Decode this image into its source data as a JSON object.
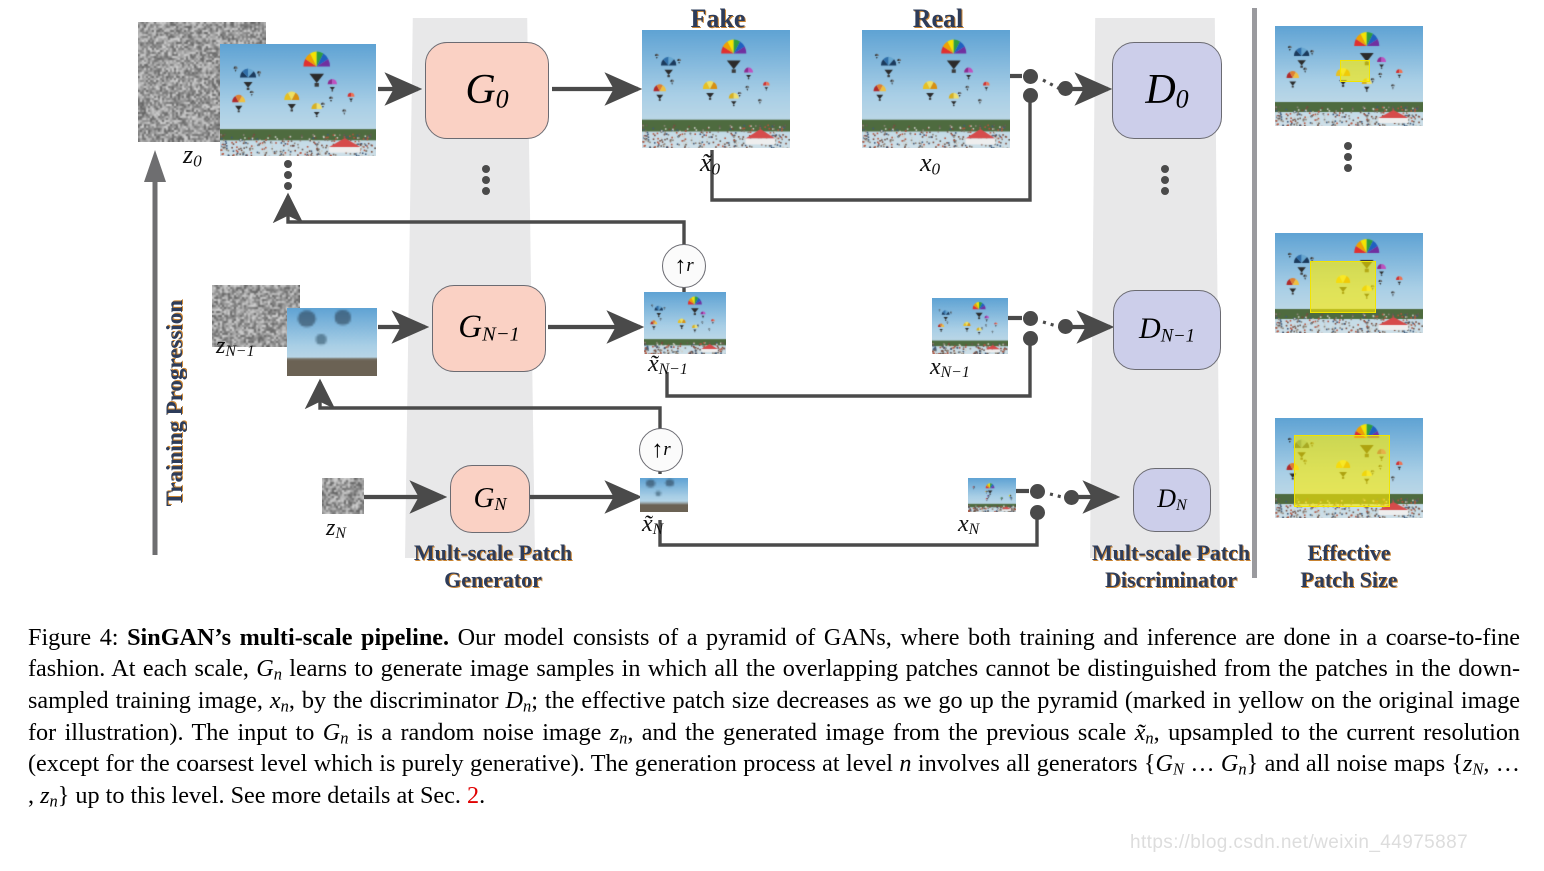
{
  "figure": {
    "training_progression_label": "Training Progression",
    "column_labels": {
      "fake": "Fake",
      "real": "Real",
      "generator_line1": "Mult-scale Patch",
      "generator_line2": "Generator",
      "discriminator_line1": "Mult-scale Patch",
      "discriminator_line2": "Discriminator",
      "patch_line1": "Effective",
      "patch_line2": "Patch Size"
    },
    "generators": [
      {
        "name": "G",
        "sub": "0",
        "noise": "z",
        "noise_sub": "0",
        "fake": "x̃",
        "fake_sub": "0",
        "real": "x",
        "real_sub": "0",
        "disc": "D",
        "disc_sub": "0"
      },
      {
        "name": "G",
        "sub": "N−1",
        "noise": "z",
        "noise_sub": "N−1",
        "fake": "x̃",
        "fake_sub": "N−1",
        "real": "x",
        "real_sub": "N−1",
        "disc": "D",
        "disc_sub": "N−1"
      },
      {
        "name": "G",
        "sub": "N",
        "noise": "z",
        "noise_sub": "N",
        "fake": "x̃",
        "fake_sub": "N",
        "real": "x",
        "real_sub": "N",
        "disc": "D",
        "disc_sub": "N"
      }
    ],
    "upsample_symbol": "↑",
    "upsample_rate": "r",
    "ellipsis_glyph": "⋮",
    "colors": {
      "generator_box": "#fad1c4",
      "discriminator_box": "#ccceea",
      "column_bg": "#e8e8e9",
      "wire": "#4a4a4a",
      "label_navy": "#2d3c5a",
      "label_orange": "#c98432",
      "patch_yellow": "#ffed00",
      "link_red": "#e00000"
    }
  },
  "caption": {
    "figure_number": "Figure 4:",
    "title": "SinGAN’s multi-scale pipeline.",
    "body_1": " Our model consists of a pyramid of GANs, where both training and inference are done in a coarse-to-fine fashion. At each scale, ",
    "m_gn_1": "G",
    "m_gn_1_sub": "n",
    "body_2": " learns to generate image samples in which all the overlapping patches cannot be distinguished from the patches in the down-sampled training image, ",
    "m_xn": "x",
    "m_xn_sub": "n",
    "body_3": ", by the discriminator ",
    "m_dn": "D",
    "m_dn_sub": "n",
    "body_4": "; the effective patch size decreases as we go up the pyramid (marked in yellow on the original image for illustration). The input to ",
    "m_gn_2": "G",
    "m_gn_2_sub": "n",
    "body_5": " is a random noise image ",
    "m_zn": "z",
    "m_zn_sub": "n",
    "body_6": ", and the generated image from the previous scale ",
    "m_xtn": "x̃",
    "m_xtn_sub": "n",
    "body_7": ", upsampled to the current resolution (except for the coarsest level which is purely generative). The generation process at level ",
    "m_n": "n",
    "body_8": " involves all generators {",
    "m_GN": "G",
    "m_GN_sub": "N",
    "body_9": " … ",
    "m_Gn3": "G",
    "m_Gn3_sub": "n",
    "body_10": "} and all noise maps {",
    "m_zN": "z",
    "m_zN_sub": "N",
    "body_11": ", … , ",
    "m_zn2": "z",
    "m_zn2_sub": "n",
    "body_12": "} up to this level. See more details at Sec. ",
    "link": "2",
    "body_13": "."
  },
  "watermark": "https://blog.csdn.net/weixin_44975887"
}
